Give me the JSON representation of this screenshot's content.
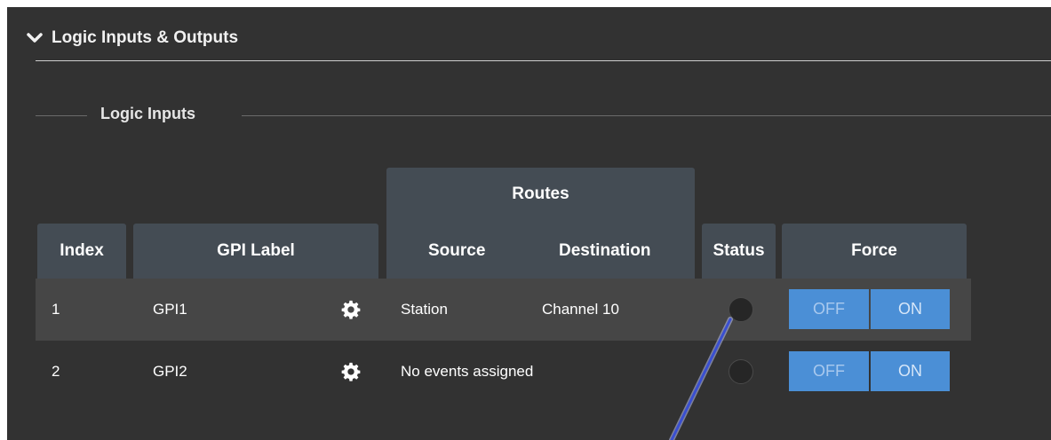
{
  "section": {
    "title": "Logic Inputs & Outputs"
  },
  "fieldset": {
    "legend": "Logic Inputs"
  },
  "table": {
    "headers": {
      "index": "Index",
      "gpi_label": "GPI Label",
      "routes": "Routes",
      "source": "Source",
      "destination": "Destination",
      "status": "Status",
      "force": "Force"
    },
    "rows": [
      {
        "index": "1",
        "label": "GPI1",
        "source": "Station",
        "destination": "Channel 10",
        "force_off": "OFF",
        "force_on": "ON"
      },
      {
        "index": "2",
        "label": "GPI2",
        "routes_text": "No events assigned",
        "force_off": "OFF",
        "force_on": "ON"
      }
    ]
  },
  "colors": {
    "panel_bg": "#323232",
    "header_cell_bg": "#444c54",
    "button_blue": "#4b8fd6",
    "pointer_blue": "#3a4fd0"
  },
  "icons": {
    "chevron": "chevron-down-icon",
    "settings": "gear-icon"
  }
}
